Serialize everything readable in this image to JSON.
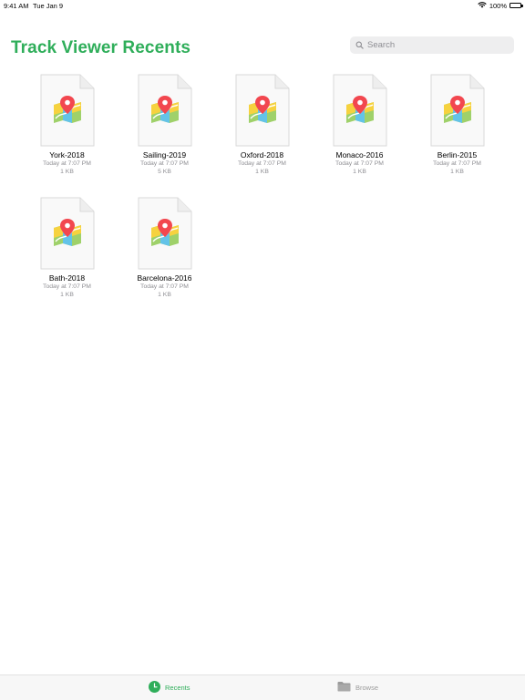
{
  "status_bar": {
    "time": "9:41 AM",
    "date": "Tue Jan 9",
    "battery": "100%"
  },
  "header": {
    "title": "Track Viewer Recents"
  },
  "search": {
    "placeholder": "Search"
  },
  "colors": {
    "accent": "#2fae5a",
    "secondary_text": "#8e8e93",
    "pin": "#f2474f"
  },
  "files": [
    {
      "name": "York-2018",
      "date": "Today at 7:07 PM",
      "size": "1 KB"
    },
    {
      "name": "Sailing-2019",
      "date": "Today at 7:07 PM",
      "size": "5 KB"
    },
    {
      "name": "Oxford-2018",
      "date": "Today at 7:07 PM",
      "size": "1 KB"
    },
    {
      "name": "Monaco-2016",
      "date": "Today at 7:07 PM",
      "size": "1 KB"
    },
    {
      "name": "Berlin-2015",
      "date": "Today at 7:07 PM",
      "size": "1 KB"
    },
    {
      "name": "Bath-2018",
      "date": "Today at 7:07 PM",
      "size": "1 KB"
    },
    {
      "name": "Barcelona-2016",
      "date": "Today at 7:07 PM",
      "size": "1 KB"
    }
  ],
  "tabs": {
    "recents": {
      "label": "Recents",
      "icon": "clock-icon",
      "selected": true
    },
    "browse": {
      "label": "Browse",
      "icon": "folder-icon",
      "selected": false
    }
  }
}
